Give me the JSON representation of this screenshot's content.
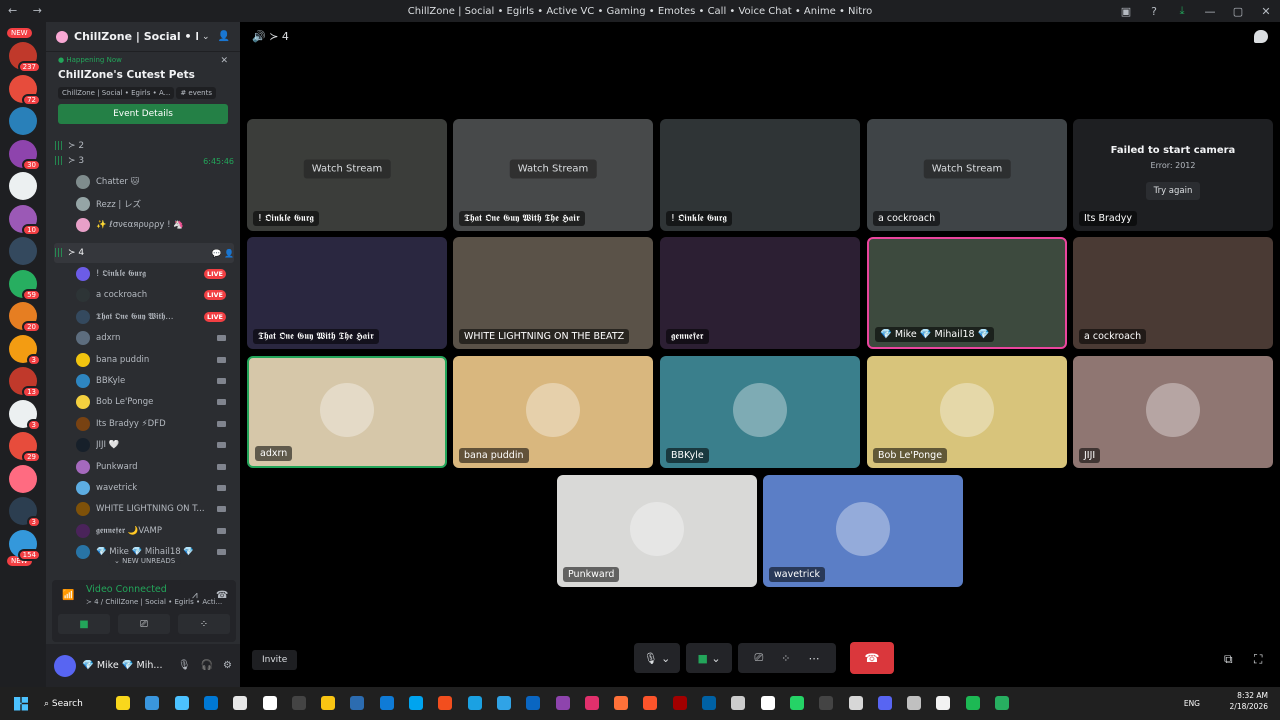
{
  "window": {
    "title": "ChillZone | Social • Egirls • Active VC • Gaming • Emotes • Call • Voice Chat • Anime • Nitro"
  },
  "servers": [
    {
      "badge": "237",
      "color": "#c0392b"
    },
    {
      "badge": "72",
      "color": "#e74c3c"
    },
    {
      "badge": "",
      "color": "#2980b9"
    },
    {
      "badge": "30",
      "color": "#8e44ad"
    },
    {
      "badge": "",
      "color": "#ecf0f1"
    },
    {
      "badge": "10",
      "color": "#9b59b6"
    },
    {
      "badge": "",
      "color": "#34495e"
    },
    {
      "badge": "59",
      "color": "#27ae60"
    },
    {
      "badge": "20",
      "color": "#e67e22"
    },
    {
      "badge": "3",
      "color": "#f39c12"
    },
    {
      "badge": "13",
      "color": "#c0392b"
    },
    {
      "badge": "3",
      "color": "#ecf0f1"
    },
    {
      "badge": "29",
      "color": "#e74c3c"
    },
    {
      "badge": "",
      "color": "#ff6b81"
    },
    {
      "badge": "3",
      "color": "#2c3e50"
    },
    {
      "badge": "154",
      "color": "#3498db"
    }
  ],
  "sidebar": {
    "server_name": "ChillZone | Social • Egirls • A...",
    "event": {
      "status": "Happening Now",
      "title": "ChillZone's Cutest Pets",
      "location": "ChillZone | Social • Egirls • A...",
      "channel": "events",
      "button": "Event Details"
    },
    "channels": [
      {
        "name": "≻ 2",
        "time": ""
      },
      {
        "name": "≻ 3",
        "time": "6:45:46"
      },
      {
        "name": "≻ 4",
        "time": ""
      }
    ],
    "users3": [
      {
        "name": "Chatter 🐱",
        "color": "#7f8c8d"
      },
      {
        "name": "Rezz | レズ",
        "color": "#95a5a6"
      },
      {
        "name": "✨ ℓσνєαяρυρρу ! 🦄",
        "color": "#e8a0c8"
      }
    ],
    "users4": [
      {
        "name": "! 𝕺𝖎𝖓𝖐𝖑𝖊 𝕲𝖚𝖗𝖌",
        "live": "LIVE",
        "color": "#6c5ce7"
      },
      {
        "name": "a cockroach",
        "live": "LIVE",
        "color": "#2d3436"
      },
      {
        "name": "𝕿𝖍𝖆𝖙 𝕺𝖓𝖊 𝕲𝖚𝖞 𝖂𝖎𝖙𝖍...",
        "live": "LIVE",
        "color": "#34495e"
      },
      {
        "name": "adxrn",
        "live": "",
        "color": "#5d6d7e"
      },
      {
        "name": "bana puddin",
        "live": "",
        "color": "#f1c40f"
      },
      {
        "name": "BBKyle",
        "live": "",
        "color": "#2e86c1"
      },
      {
        "name": "Bob Le'Ponge",
        "live": "",
        "color": "#f4d03f"
      },
      {
        "name": "Its Bradyy ⚡DFD",
        "live": "",
        "color": "#784212"
      },
      {
        "name": "JIJI 🤍",
        "live": "",
        "color": "#17202a"
      },
      {
        "name": "Punkward",
        "live": "",
        "color": "#a569bd"
      },
      {
        "name": "wavetrick",
        "live": "",
        "color": "#5dade2"
      },
      {
        "name": "WHITE LIGHTNING ON T...",
        "live": "",
        "color": "#7e5109"
      },
      {
        "name": "𝖌𝖊𝖓𝖓𝖊𝖋𝖊𝖗 🌙VAMP",
        "live": "",
        "color": "#4a235a"
      },
      {
        "name": "💎 Mike 💎 Mihail18 💎",
        "live": "",
        "color": "#2874a6"
      }
    ],
    "new_unreads": "NEW UNREADS",
    "voice": {
      "status": "Video Connected",
      "sub": "≻ 4 / ChillZone | Social • Egirls • Acti..."
    },
    "user": {
      "name": "💎 Mike 💎 Mih..."
    }
  },
  "stage": {
    "channel": "≻ 4",
    "tiles": [
      {
        "label": "! 𝕺𝖎𝖓𝖐𝖑𝖊 𝕲𝖚𝖗𝖌",
        "overlay": "Watch Stream",
        "bg": "#3b3d3a"
      },
      {
        "label": "𝕿𝖍𝖆𝖙 𝕺𝖓𝖊 𝕲𝖚𝖞 𝖂𝖎𝖙𝖍 𝕿𝖍𝖊 𝕳𝖆𝖎𝖗",
        "overlay": "Watch Stream",
        "bg": "#47494a"
      },
      {
        "label": "! 𝕺𝖎𝖓𝖐𝖑𝖊 𝕲𝖚𝖗𝖌",
        "overlay": "",
        "bg": "#2f3436"
      },
      {
        "label": "a cockroach",
        "overlay": "Watch Stream",
        "bg": "#3f4447"
      },
      {
        "label": "Its Bradyy",
        "overlay": "",
        "bg": "#1e1f22",
        "fail_title": "Failed to start camera",
        "fail_sub": "Error: 2012",
        "fail_btn": "Try again"
      },
      {
        "label": "𝕿𝖍𝖆𝖙 𝕺𝖓𝖊 𝕲𝖚𝖞 𝖂𝖎𝖙𝖍 𝕿𝖍𝖊 𝕳𝖆𝖎𝖗",
        "overlay": "",
        "bg": "#2a2740"
      },
      {
        "label": "WHITE LIGHTNING ON THE BEATZ",
        "overlay": "",
        "bg": "#5a5248"
      },
      {
        "label": "𝖌𝖊𝖓𝖓𝖊𝖋𝖊𝖗",
        "overlay": "",
        "bg": "#2c1f33"
      },
      {
        "label": "💎 Mike 💎 Mihail18 💎",
        "overlay": "",
        "bg": "#3d4a3e"
      },
      {
        "label": "a cockroach",
        "overlay": "",
        "bg": "#4a3a34"
      },
      {
        "label": "adxrn",
        "overlay": "",
        "bg": "#d6c7a9"
      },
      {
        "label": "bana puddin",
        "overlay": "",
        "bg": "#d9b77e"
      },
      {
        "label": "BBKyle",
        "overlay": "",
        "bg": "#3a7f8c"
      },
      {
        "label": "Bob Le'Ponge",
        "overlay": "",
        "bg": "#d8c47b"
      },
      {
        "label": "JIJI",
        "overlay": "",
        "bg": "#8f7672"
      },
      {
        "label": "Punkward",
        "overlay": "",
        "bg": "#d9d9d7"
      },
      {
        "label": "wavetrick",
        "overlay": "",
        "bg": "#5b7ec6"
      }
    ],
    "invite": "Invite"
  },
  "taskbar": {
    "search": "Search",
    "lang": "ENG",
    "time": "8:32 AM",
    "date": "2/18/2026"
  }
}
